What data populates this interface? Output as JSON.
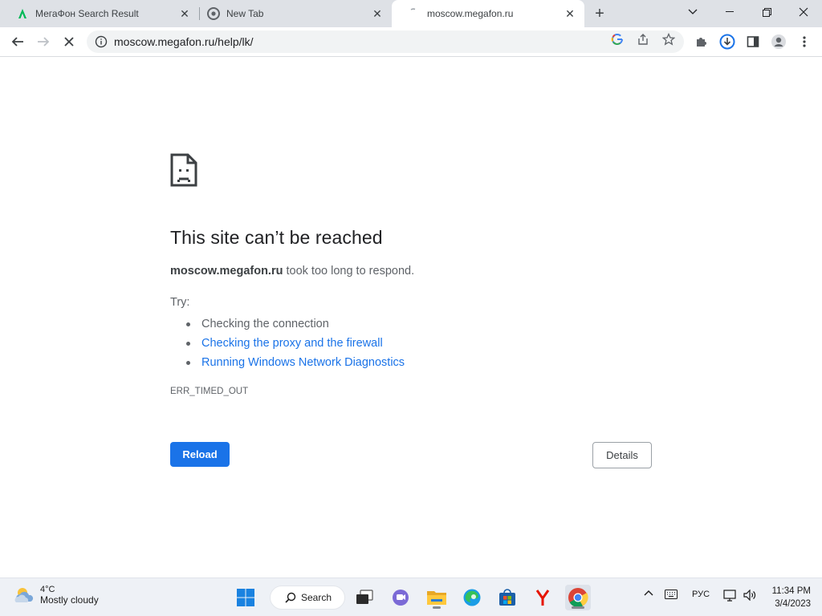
{
  "browser": {
    "tabs": [
      {
        "title": "МегаФон Search Result",
        "favicon": "megafon-icon",
        "active": false
      },
      {
        "title": "New Tab",
        "favicon": "chrome-icon",
        "active": false
      },
      {
        "title": "moscow.megafon.ru",
        "favicon": "loading-icon",
        "active": true
      }
    ],
    "new_tab_symbol": "+",
    "close_symbol": "✕",
    "url": "moscow.megafon.ru/help/lk/"
  },
  "error_page": {
    "title": "This site can’t be reached",
    "host": "moscow.megafon.ru",
    "description_rest": " took too long to respond.",
    "try_label": "Try:",
    "suggestions": [
      {
        "text": "Checking the connection",
        "is_link": false
      },
      {
        "text": "Checking the proxy and the firewall",
        "is_link": true
      },
      {
        "text": "Running Windows Network Diagnostics",
        "is_link": true
      }
    ],
    "error_code": "ERR_TIMED_OUT",
    "reload_label": "Reload",
    "details_label": "Details"
  },
  "taskbar": {
    "weather_temp": "4°C",
    "weather_condition": "Mostly cloudy",
    "search_label": "Search",
    "language": "РУС",
    "time": "11:34 PM",
    "date": "3/4/2023"
  },
  "colors": {
    "accent_blue": "#1a73e8",
    "tabstrip_bg": "#dee1e6",
    "taskbar_bg": "#eef1f6"
  }
}
